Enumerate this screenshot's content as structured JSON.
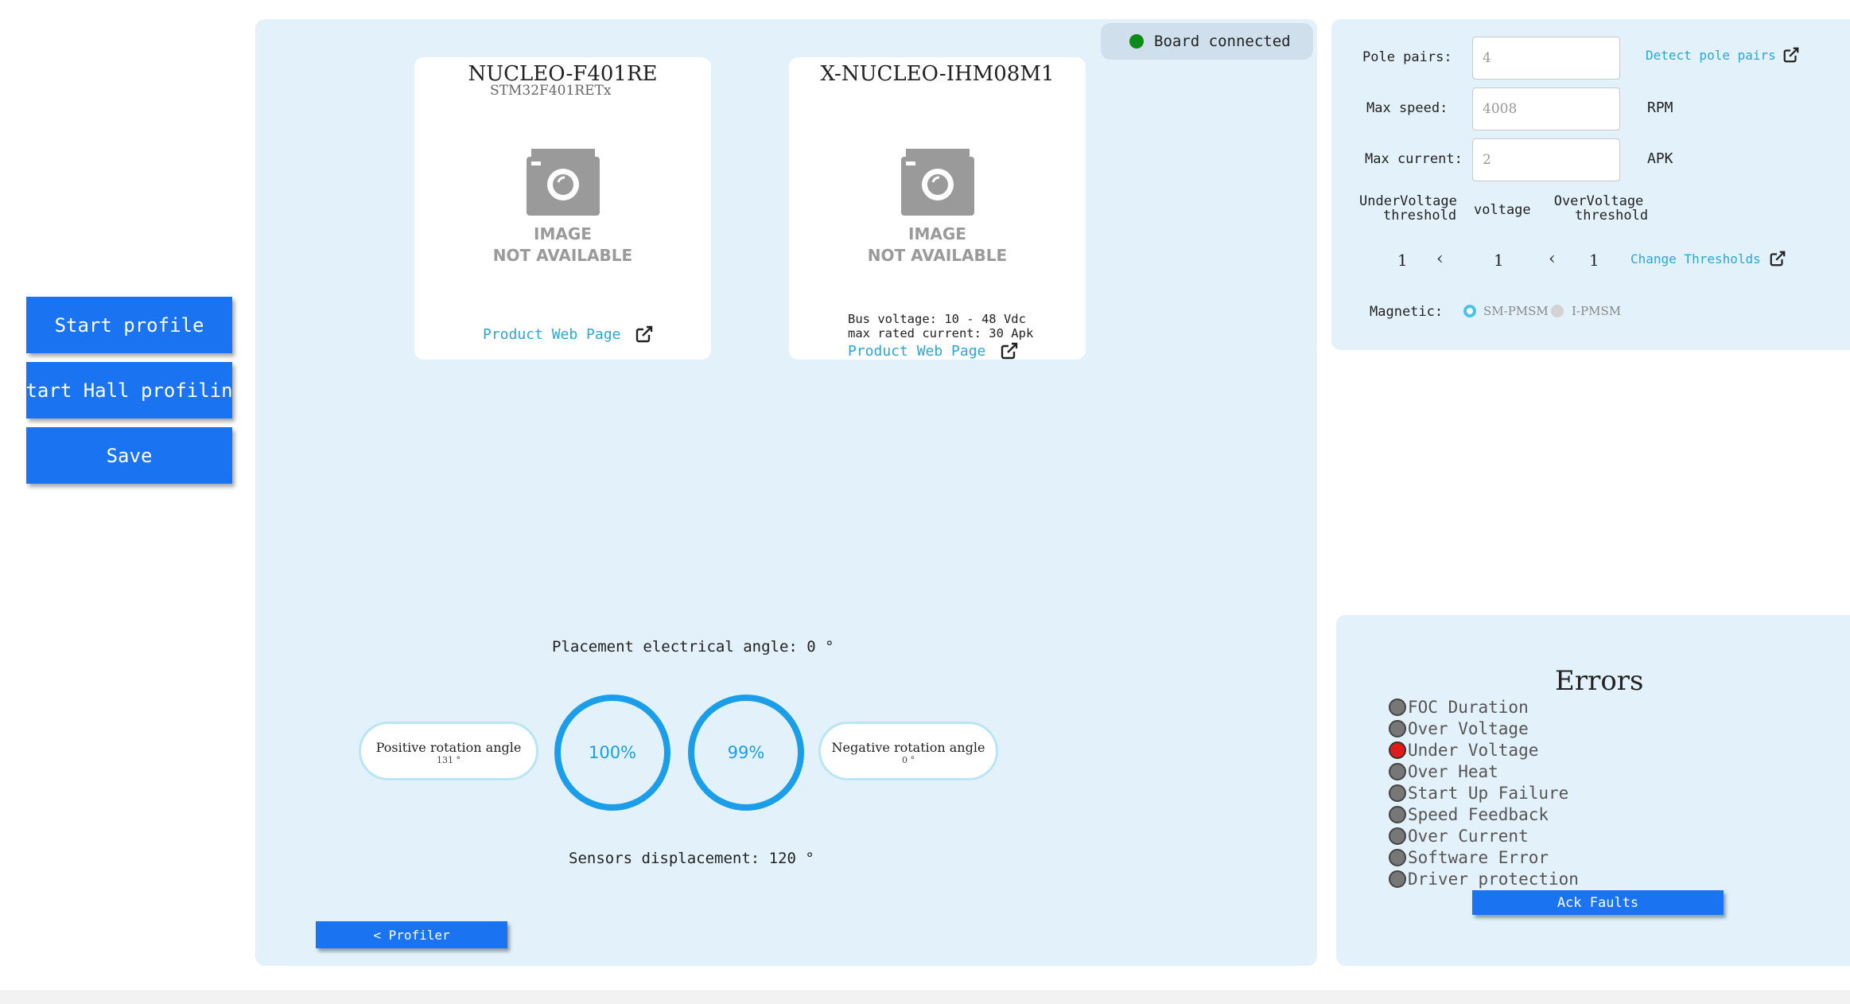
{
  "sidebar": {
    "start_profile": "Start profile",
    "start_hall": "Start Hall profiling",
    "save": "Save"
  },
  "status": {
    "label": "Board connected",
    "color": "#0c8a1a"
  },
  "boards": [
    {
      "title": "NUCLEO-F401RE",
      "subtitle": "STM32F401RETx",
      "image_line1": "IMAGE",
      "image_line2": "NOT AVAILABLE",
      "link": "Product Web Page"
    },
    {
      "title": "X-NUCLEO-IHM08M1",
      "image_line1": "IMAGE",
      "image_line2": "NOT AVAILABLE",
      "spec1": "Bus voltage: 10 - 48 Vdc",
      "spec2": "max rated current: 30 Apk",
      "link": "Product Web Page"
    }
  ],
  "hall": {
    "placement": "Placement electrical angle: 0 °",
    "positive_label": "Positive rotation angle",
    "positive_value": "131 °",
    "positive_pct": "100%",
    "negative_pct": "99%",
    "negative_label": "Negative rotation angle",
    "negative_value": "0 °",
    "displacement": "Sensors displacement: 120 °",
    "back_button": "< Profiler"
  },
  "settings": {
    "pole_pairs_label": "Pole pairs:",
    "pole_pairs_value": "4",
    "detect_link": "Detect pole pairs",
    "max_speed_label": "Max speed:",
    "max_speed_value": "4008",
    "max_speed_unit": "RPM",
    "max_current_label": "Max current:",
    "max_current_value": "2",
    "max_current_unit": "APK",
    "uv_label_1": "UnderVoltage",
    "uv_label_2": "threshold",
    "voltage_label": "voltage",
    "ov_label_1": "OverVoltage",
    "ov_label_2": "threshold",
    "uv_value": "1",
    "voltage_value": "1",
    "ov_value": "1",
    "change_link": "Change Thresholds",
    "magnetic_label": "Magnetic:",
    "option_sm": "SM-PMSM",
    "option_i": "I-PMSM"
  },
  "errors": {
    "title": "Errors",
    "items": [
      {
        "label": "FOC Duration",
        "active": false
      },
      {
        "label": "Over Voltage",
        "active": false
      },
      {
        "label": "Under Voltage",
        "active": true
      },
      {
        "label": "Over Heat",
        "active": false
      },
      {
        "label": "Start Up Failure",
        "active": false
      },
      {
        "label": "Speed Feedback",
        "active": false
      },
      {
        "label": "Over Current",
        "active": false
      },
      {
        "label": "Software Error",
        "active": false
      },
      {
        "label": "Driver protection",
        "active": false
      }
    ],
    "ack_button": "Ack Faults"
  },
  "colors": {
    "accent": "#1a73f0",
    "panel": "#e3f1fb",
    "link": "#2aa7d8",
    "ring": "#1b9eea",
    "error_active": "#e01b1b"
  }
}
